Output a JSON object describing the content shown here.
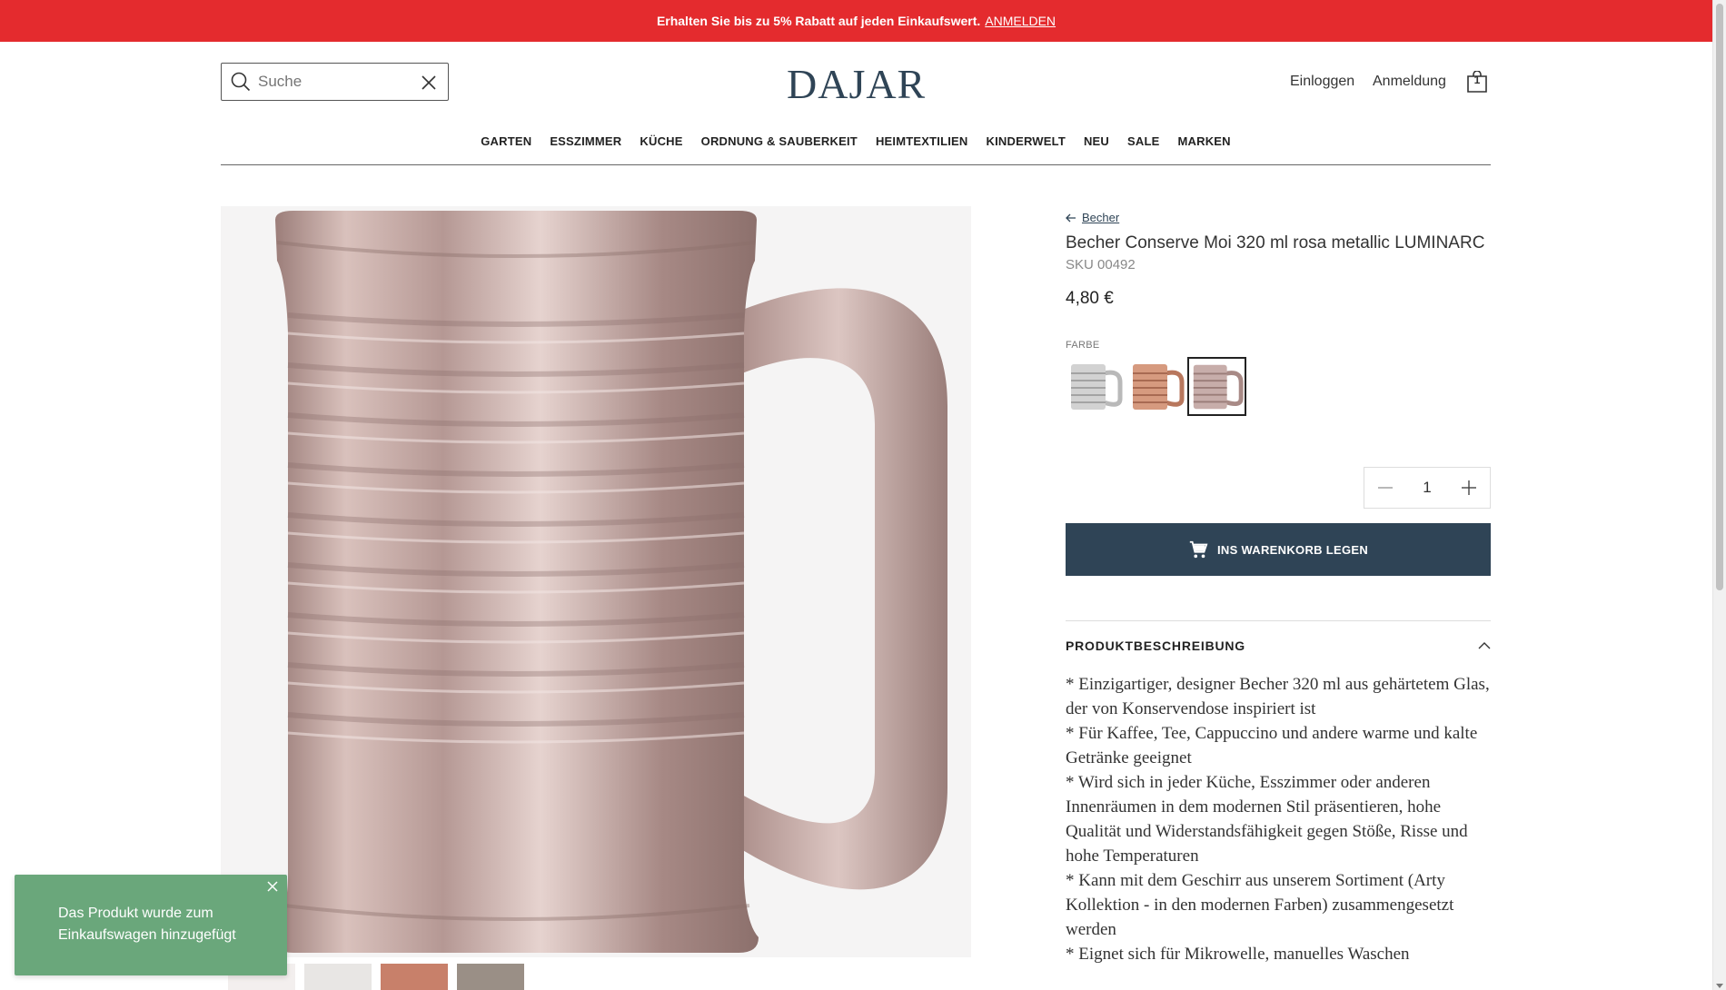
{
  "promo": {
    "text": "Erhalten Sie bis zu 5% Rabatt auf jeden Einkaufswert.",
    "link": "ANMELDEN"
  },
  "search": {
    "placeholder": "Suche"
  },
  "logo": "DAJAR",
  "header": {
    "login": "Einloggen",
    "register": "Anmeldung",
    "cart_count": "1"
  },
  "nav": [
    "GARTEN",
    "ESSZIMMER",
    "KÜCHE",
    "ORDNUNG & SAUBERKEIT",
    "HEIMTEXTILIEN",
    "KINDERWELT",
    "NEU",
    "SALE",
    "MARKEN"
  ],
  "product": {
    "breadcrumb": "Becher",
    "title": "Becher Conserve Moi 320 ml rosa metallic LUMINARC",
    "sku": "SKU 00492",
    "price": "4,80 €",
    "color_label": "FARBE",
    "quantity": "1",
    "add_to_cart": "INS WARENKORB LEGEN"
  },
  "description": {
    "heading": "PRODUKTBESCHREIBUNG",
    "lines": [
      "* Einzigartiger, designer Becher 320 ml aus gehärtetem Glas, der von Konservendose inspiriert ist",
      "* Für Kaffee, Tee, Cappuccino und andere warme und kalte Getränke geeignet",
      "* Wird sich in jeder Küche, Esszimmer oder anderen Innenräumen in dem modernen Stil präsentieren, hohe Qualität und Widerstandsfähigkeit gegen Stöße, Risse und hohe Temperaturen",
      "* Kann mit dem Geschirr aus unserem Sortiment (Arty Kollektion - in den modernen Farben) zusammengesetzt werden",
      "* Eignet sich für Mikrowelle, manuelles Waschen"
    ]
  },
  "toast": {
    "message": "Das Produkt wurde zum Einkaufswagen hinzugefügt"
  },
  "colors": {
    "brand": "#2f4456",
    "promo": "#e42b2e",
    "toast": "#6aa77b"
  }
}
